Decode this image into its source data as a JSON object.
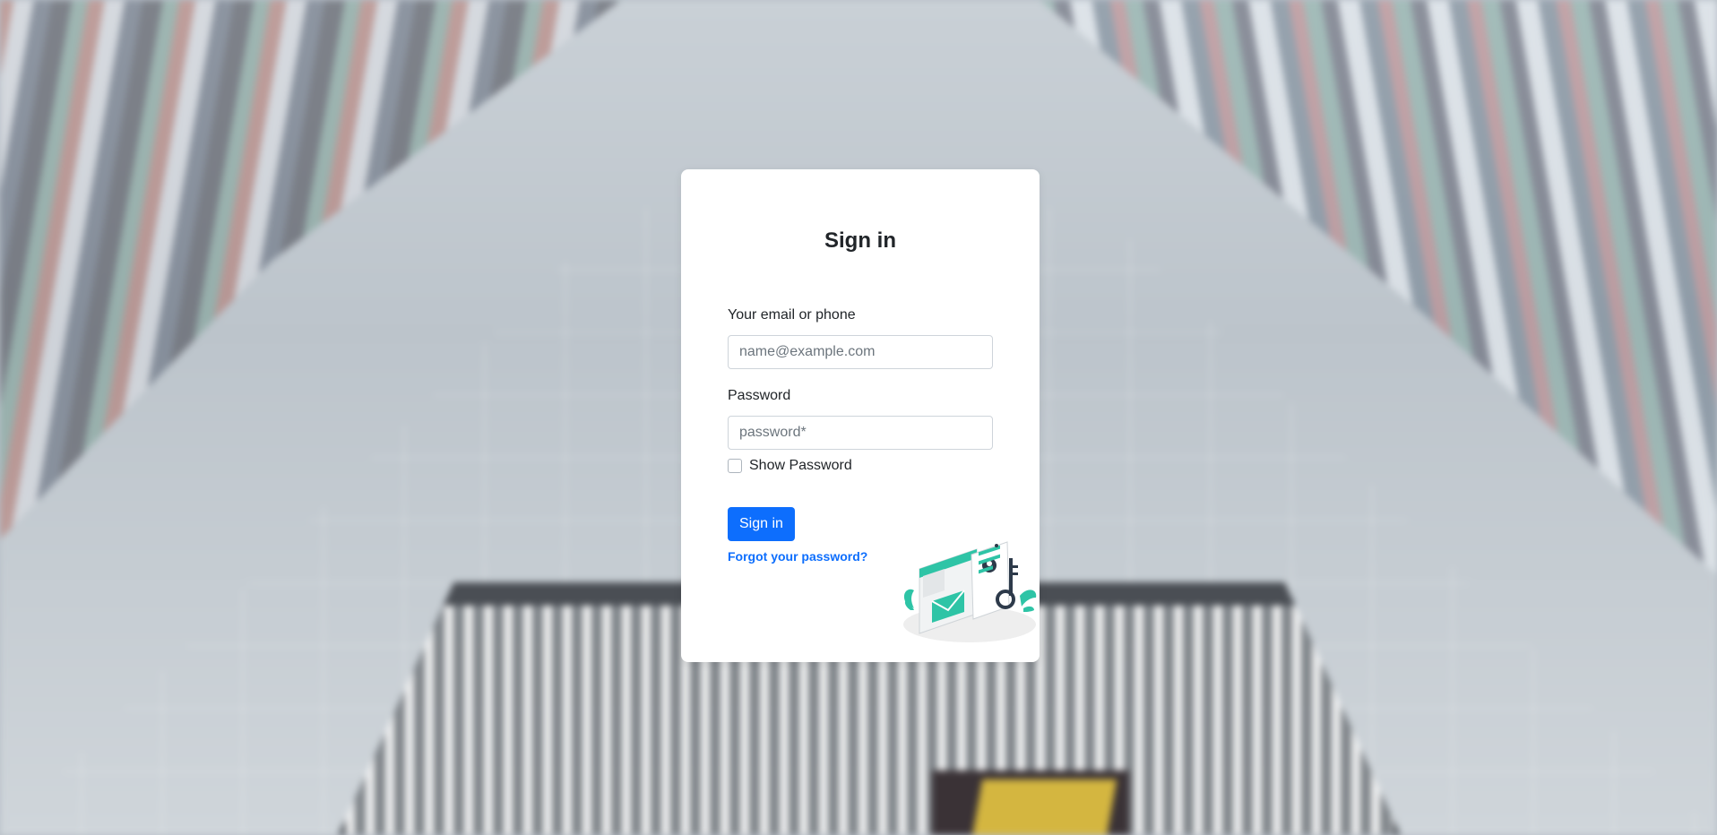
{
  "login": {
    "title": "Sign in",
    "email_label": "Your email or phone",
    "email_placeholder": "name@example.com",
    "email_value": "",
    "password_label": "Password",
    "password_placeholder": "password*",
    "password_value": "",
    "show_password_label": "Show Password",
    "show_password_checked": false,
    "submit_label": "Sign in",
    "forgot_label": "Forgot your password?"
  },
  "colors": {
    "primary": "#0d6efd",
    "text": "#212529",
    "illustration_accent": "#2ec4a6"
  },
  "icons": {
    "illustration": "login-key-envelope-illustration"
  }
}
